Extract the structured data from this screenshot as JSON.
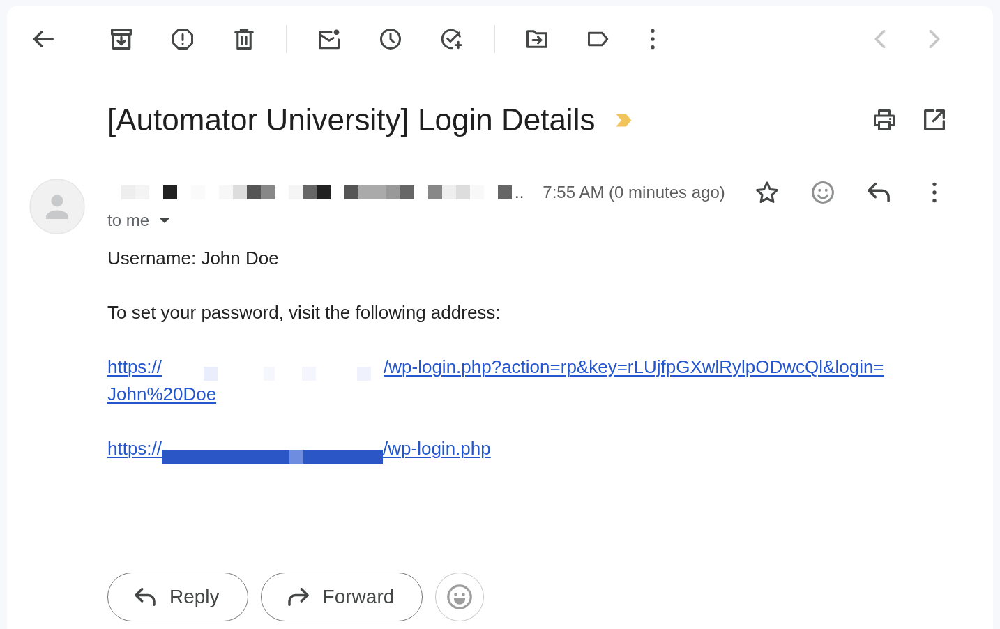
{
  "toolbar": {
    "pager": [
      {
        "kind": "previous",
        "disabled": true
      },
      {
        "kind": "next",
        "disabled": true
      }
    ]
  },
  "message": {
    "subject": "[Automator University] Login Details",
    "important": true,
    "sender": {
      "name_tail": ".."
    },
    "time": "7:55 AM (0 minutes ago)",
    "starred": false,
    "recipient": "to me",
    "body": [
      {
        "kind": "text",
        "text": "Username: John Doe"
      },
      {
        "kind": "text",
        "text": "To set your password, visit the following address:"
      },
      {
        "kind": "link",
        "redaction": {
          "kind": "pixelated"
        },
        "before": "https://",
        "after": "/wp-login.php?action=rp&key=rLUjfpGXwlRylpODwcQl&login=",
        "continued": "John%20Doe"
      },
      {
        "kind": "link",
        "redaction": {
          "kind": "bar"
        },
        "before": "https://",
        "after": "/wp-login.php"
      }
    ]
  },
  "actions": [
    {
      "kind": "reply",
      "label": "Reply"
    },
    {
      "kind": "forward",
      "label": "Forward"
    }
  ]
}
